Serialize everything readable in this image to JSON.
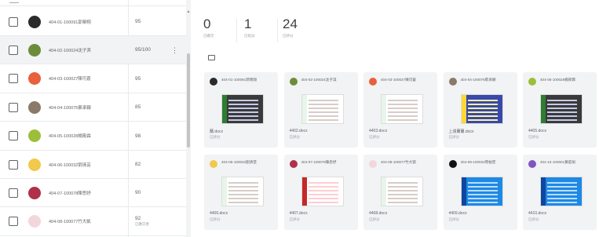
{
  "students": [
    {
      "name": "404-01-100091郭榮翔",
      "score": "95",
      "avatar_color": "#2b2b2b",
      "highlight": false
    },
    {
      "name": "404-02-100024沈子淇",
      "score": "95/100",
      "avatar_color": "#6d8c3a",
      "highlight": true
    },
    {
      "name": "404-03-100027陳可蒼",
      "score": "95",
      "avatar_color": "#e8603c",
      "highlight": false
    },
    {
      "name": "404-04-100075蔡承穎",
      "score": "85",
      "avatar_color": "#8a7a6a",
      "highlight": false
    },
    {
      "name": "404-05-100028楊筱霖",
      "score": "98",
      "avatar_color": "#9bbf3a",
      "highlight": false
    },
    {
      "name": "404-06-100032劉清芸",
      "score": "82",
      "avatar_color": "#f2c94c",
      "highlight": false
    },
    {
      "name": "404-07-100078陳思妤",
      "score": "90",
      "avatar_color": "#b0304a",
      "highlight": false
    },
    {
      "name": "404-08-100077竹大凱",
      "score": "92",
      "score_note": "已繳交者",
      "avatar_color": "#f3d6dc",
      "highlight": false
    }
  ],
  "stats": [
    {
      "value": "0",
      "label": "已繳交"
    },
    {
      "value": "1",
      "label": "已指派"
    },
    {
      "value": "24",
      "label": "已評分"
    }
  ],
  "cards": [
    {
      "title": "404-01-100091郭榮翔",
      "file": "蘭.docx",
      "status": "已評分",
      "avatar_color": "#2b2b2b",
      "thumb": "dark"
    },
    {
      "title": "404-02-100024沈子淇",
      "file": "4402.docx",
      "status": "已評分",
      "avatar_color": "#6d8c3a",
      "thumb": "light"
    },
    {
      "title": "404-03-100027陳可蒼",
      "file": "4403.docx",
      "status": "已評分",
      "avatar_color": "#e8603c",
      "thumb": "light"
    },
    {
      "title": "404-04-100075蔡承穎",
      "file": "上週蘭蘭.docx",
      "status": "已評分",
      "avatar_color": "#8a7a6a",
      "thumb": "purple"
    },
    {
      "title": "404-05-100028楊筱霖",
      "file": "4405.docx",
      "status": "已評分",
      "avatar_color": "#9bbf3a",
      "thumb": "dark"
    },
    {
      "title": "404-06-100032劉清芸",
      "file": "4406.docx",
      "status": "已評分",
      "avatar_color": "#f2c94c",
      "thumb": "light"
    },
    {
      "title": "404-07-100078陳思妤",
      "file": "4407.docx",
      "status": "已評分",
      "avatar_color": "#b0304a",
      "thumb": "red"
    },
    {
      "title": "404-08-100077竹大凱",
      "file": "4408.docx",
      "status": "已評分",
      "avatar_color": "#f3d6dc",
      "thumb": "light"
    },
    {
      "title": "404-09-100033周柏宏",
      "file": "4409.docx",
      "status": "已評分",
      "avatar_color": "#111111",
      "thumb": "blue"
    },
    {
      "title": "404-10-100001黃庭如",
      "file": "4410.docx",
      "status": "已評分",
      "avatar_color": "#7e57c2",
      "thumb": "blue"
    }
  ]
}
